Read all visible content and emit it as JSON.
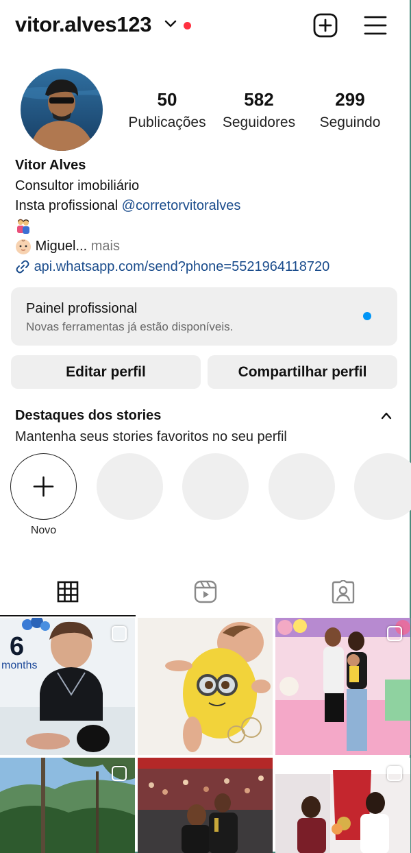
{
  "header": {
    "username": "vitor.alves123"
  },
  "stats": {
    "posts": {
      "value": "50",
      "label": "Publicações"
    },
    "followers": {
      "value": "582",
      "label": "Seguidores"
    },
    "following": {
      "value": "299",
      "label": "Seguindo"
    }
  },
  "bio": {
    "name": "Vitor Alves",
    "line1": "Consultor imobiliário",
    "line2_prefix": "Insta profissional ",
    "line2_handle": "@corretorvitoralves",
    "line4_text": "Miguel...",
    "line4_more": " mais",
    "link": "api.whatsapp.com/send?phone=5521964118720"
  },
  "panel": {
    "title": "Painel profissional",
    "subtitle": "Novas ferramentas já estão disponíveis."
  },
  "buttons": {
    "edit": "Editar perfil",
    "share": "Compartilhar perfil"
  },
  "highlights": {
    "title": "Destaques dos stories",
    "subtitle": "Mantenha seus stories favoritos no seu perfil",
    "new_label": "Novo"
  },
  "grid": {
    "post1_text_big": "6",
    "post1_text_small": "months"
  },
  "colors": {
    "notification_dot": "#ff3040",
    "link": "#1a4c8c",
    "panel_dot": "#0095f6"
  },
  "icons": [
    "chevron-down-icon",
    "add-post-icon",
    "menu-icon",
    "link-icon",
    "grid-icon",
    "reels-icon",
    "tagged-icon",
    "plus-icon"
  ]
}
